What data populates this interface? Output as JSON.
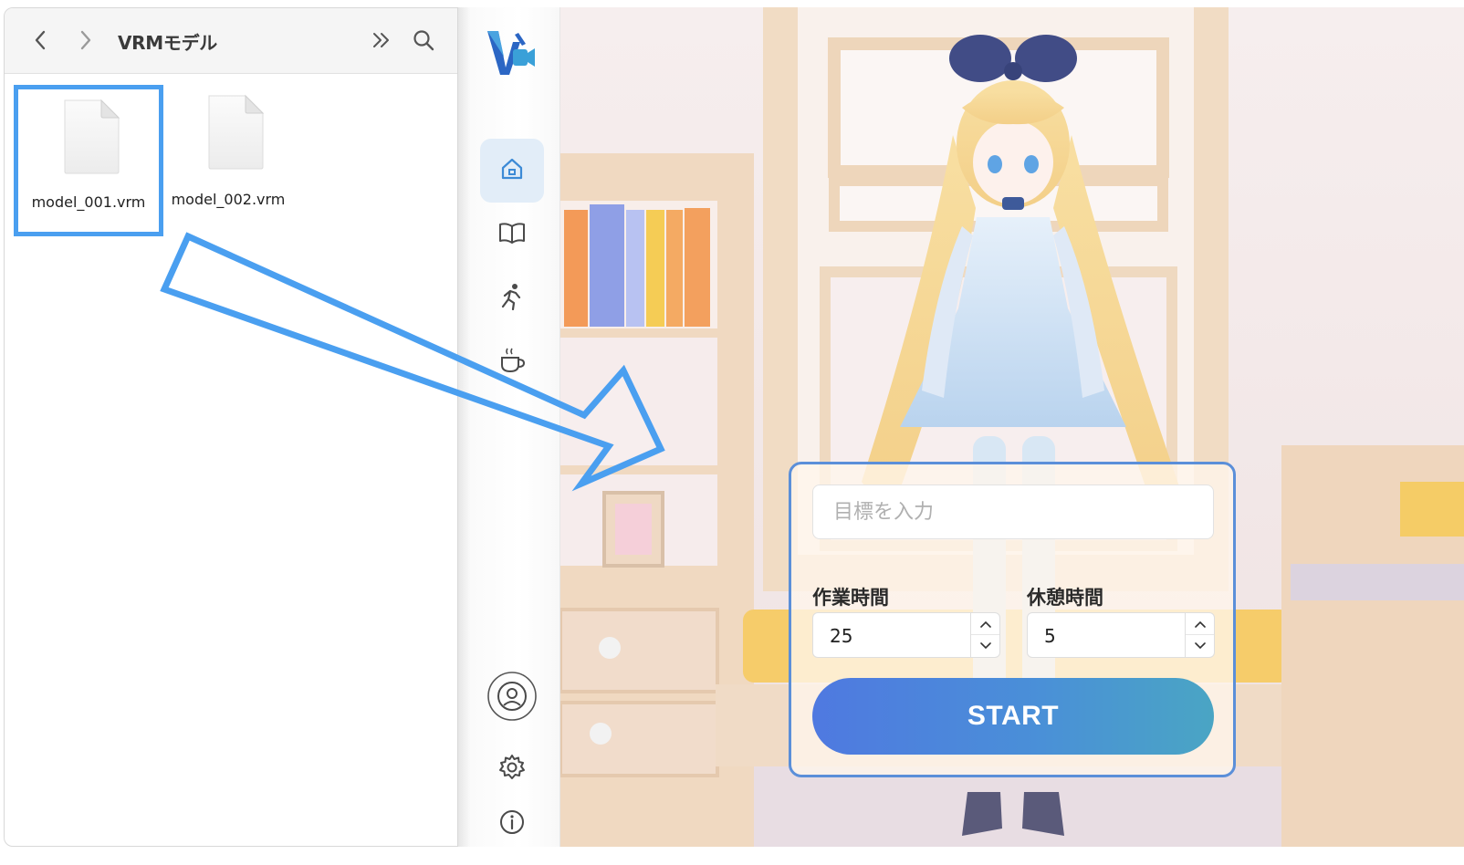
{
  "finder": {
    "title": "VRMモデル",
    "files": [
      {
        "name": "model_001.vrm",
        "selected": true
      },
      {
        "name": "model_002.vrm",
        "selected": false
      }
    ],
    "icons": {
      "back": "chevron-left-icon",
      "forward": "chevron-right-icon",
      "more": "double-chevron-right-icon",
      "search": "search-icon"
    }
  },
  "app": {
    "sidebar": {
      "items": [
        {
          "icon": "home-icon",
          "active": true
        },
        {
          "icon": "book-icon",
          "active": false
        },
        {
          "icon": "running-person-icon",
          "active": false
        },
        {
          "icon": "mug-icon",
          "active": false
        },
        {
          "icon": "user-circle-icon",
          "active": false
        },
        {
          "icon": "gear-icon",
          "active": false
        },
        {
          "icon": "info-icon",
          "active": false
        }
      ]
    },
    "timer_panel": {
      "goal_placeholder": "目標を入力",
      "goal_value": "",
      "work_label": "作業時間",
      "work_value": "25",
      "break_label": "休憩時間",
      "break_value": "5",
      "start_label": "START"
    }
  },
  "colors": {
    "accent_blue": "#4a9ff0",
    "panel_border": "#5b8fd9",
    "start_gradient_start": "#4f79e0",
    "start_gradient_end": "#4aa5c4",
    "active_nav_bg": "#e2edf8"
  }
}
